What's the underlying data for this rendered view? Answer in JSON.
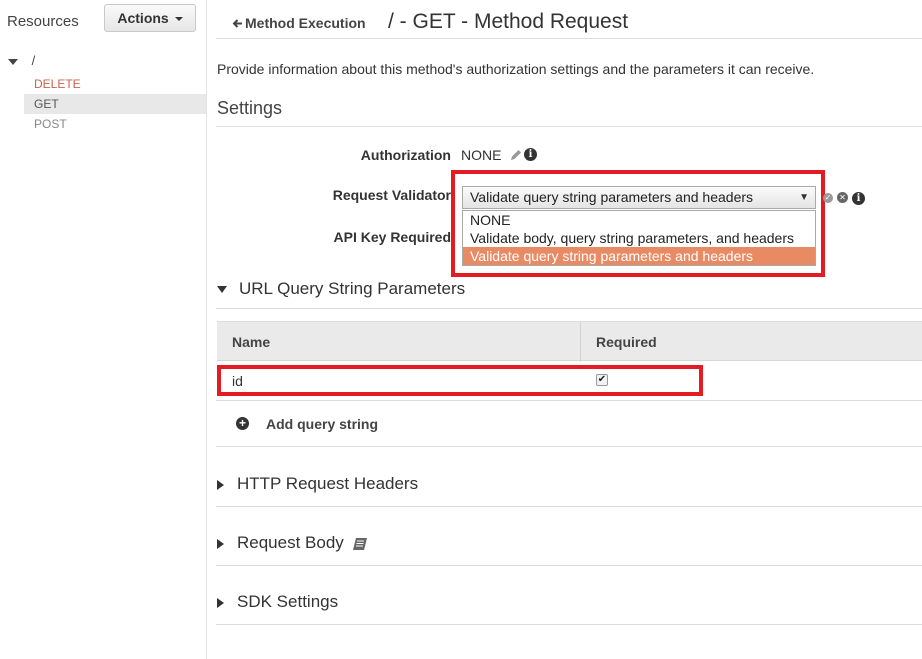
{
  "sidebar": {
    "title": "Resources",
    "actions_label": "Actions",
    "root_path": "/",
    "methods": [
      "DELETE",
      "GET",
      "POST"
    ]
  },
  "header": {
    "back_label": "Method Execution",
    "title": "/ - GET - Method Request",
    "description": "Provide information about this method's authorization settings and the parameters it can receive."
  },
  "settings": {
    "title": "Settings",
    "authorization": {
      "label": "Authorization",
      "value": "NONE"
    },
    "request_validator": {
      "label": "Request Validator",
      "selected": "Validate query string parameters and headers",
      "options": [
        "NONE",
        "Validate body, query string parameters, and headers",
        "Validate query string parameters and headers"
      ],
      "highlighted_option_index": 2
    },
    "api_key": {
      "label": "API Key Required"
    }
  },
  "url_query": {
    "title": "URL Query String Parameters",
    "columns": [
      "Name",
      "Required"
    ],
    "rows": [
      {
        "name": "id",
        "required": true
      }
    ],
    "add_label": "Add query string"
  },
  "sections": {
    "http_headers": "HTTP Request Headers",
    "request_body": "Request Body",
    "sdk_settings": "SDK Settings"
  },
  "colors": {
    "highlight_border": "#e31b23",
    "selected_option_bg": "#e88a63",
    "delete_method": "#c7644e"
  }
}
